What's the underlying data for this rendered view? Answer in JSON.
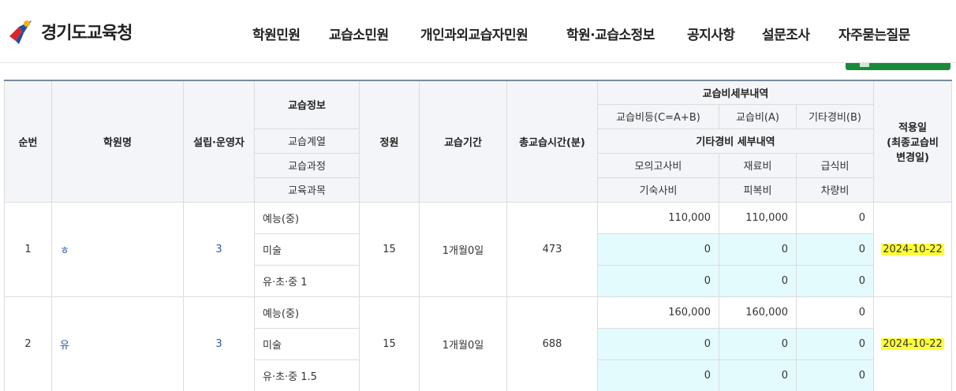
{
  "header": {
    "logo_text": "경기도교육청",
    "nav": [
      {
        "label": "학원민원"
      },
      {
        "label": "교습소민원"
      },
      {
        "label": "개인과외교습자민원"
      },
      {
        "label": "학원·교습소정보"
      },
      {
        "label": "공지사항"
      },
      {
        "label": "설문조사"
      },
      {
        "label": "자주묻는질문"
      }
    ]
  },
  "colors": {
    "highlight": "#ffff3a",
    "cyan_cell": "#e4fbfd",
    "header_bg": "#f3f5f8",
    "button_green": "#1a8a3a",
    "link_blue": "#2a5aa8"
  },
  "table": {
    "headers": {
      "no": "순번",
      "academy": "학원명",
      "founder": "설립·운영자",
      "lesson_info": "교습정보",
      "lesson_series": "교습계열",
      "lesson_course": "교습과정",
      "subject": "교육과목",
      "capacity": "정원",
      "period": "교습기간",
      "total_minutes": "총교습시간(분)",
      "fee_detail": "교습비세부내역",
      "fee_total": "교습비등(C=A+B)",
      "fee_a": "교습비(A)",
      "fee_b": "기타경비(B)",
      "other_detail": "기타경비 세부내역",
      "mock_exam": "모의고사비",
      "material": "재료비",
      "meal": "급식비",
      "dorm": "기숙사비",
      "clothes": "피복비",
      "vehicle": "차량비",
      "apply_date_1": "적용일",
      "apply_date_2": "(최종교습비",
      "apply_date_3": "변경일)"
    },
    "rows": [
      {
        "no": "1",
        "academy": "ㅎ",
        "founder": "3",
        "series": "예능(중)",
        "course": "미술",
        "subject": "유·초·중 1",
        "capacity": "15",
        "period": "1개월0일",
        "total_minutes": "473",
        "fee_total": "110,000",
        "fee_a": "110,000",
        "fee_b": "0",
        "mock_exam": "0",
        "material": "0",
        "meal": "0",
        "dorm": "0",
        "clothes": "0",
        "vehicle": "0",
        "apply_date": "2024-10-22"
      },
      {
        "no": "2",
        "academy": "유",
        "founder": "3",
        "series": "예능(중)",
        "course": "미술",
        "subject": "유·초·중 1.5",
        "capacity": "15",
        "period": "1개월0일",
        "total_minutes": "688",
        "fee_total": "160,000",
        "fee_a": "160,000",
        "fee_b": "0",
        "mock_exam": "0",
        "material": "0",
        "meal": "0",
        "dorm": "0",
        "clothes": "0",
        "vehicle": "0",
        "apply_date": "2024-10-22"
      }
    ]
  }
}
